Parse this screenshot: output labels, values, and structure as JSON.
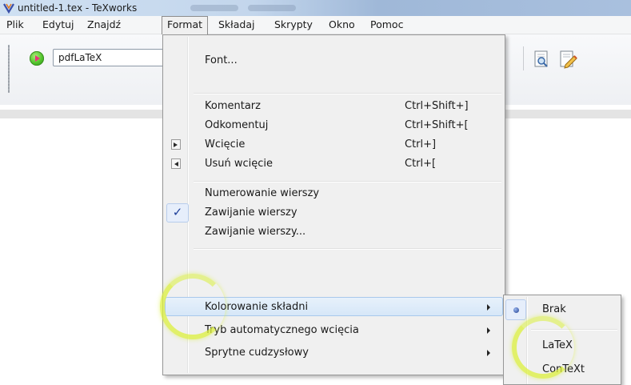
{
  "window": {
    "title": "untitled-1.tex - TeXworks"
  },
  "menubar": {
    "items": [
      "Plik",
      "Edytuj",
      "Znajdź",
      "Format",
      "Składaj",
      "Skrypty",
      "Okno",
      "Pomoc"
    ],
    "active": "Format"
  },
  "toolbar": {
    "engine": "pdfLaTeX",
    "icons": [
      "typeset-icon",
      "preview-search-icon",
      "edit-pencil-icon"
    ]
  },
  "format_menu": {
    "font": "Font...",
    "comment": {
      "label": "Komentarz",
      "shortcut": "Ctrl+Shift+]"
    },
    "uncomment": {
      "label": "Odkomentuj",
      "shortcut": "Ctrl+Shift+["
    },
    "indent": {
      "label": "Wcięcie",
      "shortcut": "Ctrl+]"
    },
    "unindent": {
      "label": "Usuń wcięcie",
      "shortcut": "Ctrl+["
    },
    "line_numbers": "Numerowanie wierszy",
    "wrap_lines": {
      "label": "Zawijanie wierszy",
      "checked": true
    },
    "wrap_lines_dialog": "Zawijanie wierszy...",
    "syntax_coloring": "Kolorowanie składni",
    "auto_indent": "Tryb automatycznego wcięcia",
    "smart_quotes": "Sprytne cudzysłowy"
  },
  "syntax_submenu": {
    "items": [
      "Brak",
      "LaTeX",
      "ConTeXt"
    ],
    "selected": "Brak"
  },
  "colors": {
    "accent": "#3b6fd6",
    "menu_bg": "#f0f0f0",
    "highlight": "#d6e7f8",
    "click_ring": "#dcf03c"
  }
}
